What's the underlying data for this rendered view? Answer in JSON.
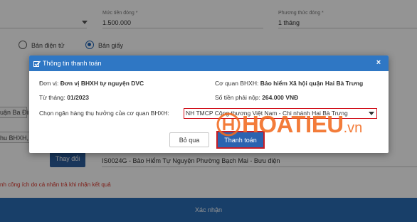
{
  "background": {
    "amount_label": "Mức tiền đóng *",
    "amount_value": "1.500.000",
    "method_label": "Phương thức đóng *",
    "method_value": "1 tháng",
    "radio_electronic": "Bản điện tử",
    "radio_paper": "Bản giấy",
    "left_text_1": "uận Ba Đình",
    "left_text_2": "hu BHXH, Bư",
    "change_button": "Thay đổi",
    "agency_text": "IS0024G - Bảo Hiểm Tự Nguyện Phường Bạch Mai - Bưu điện",
    "note_text": "nh công ích do cá nhân trả khi nhận kết quả",
    "confirm_button": "Xác nhận"
  },
  "modal": {
    "title": "Thông tin thanh toán",
    "unit_label": "Đơn vị:",
    "unit_value": "Đơn vị BHXH tự nguyện DVC",
    "agency_label": "Cơ quan BHXH:",
    "agency_value": "Bảo hiểm Xã hội quận Hai Bà Trưng",
    "from_label": "Từ tháng:",
    "from_value": "01/2023",
    "amount_label": "Số tiền phải nộp:",
    "amount_value": "264.000 VNĐ",
    "bank_label": "Chọn ngân hàng thụ hưởng của cơ quan BHXH:",
    "bank_selected": "NH TMCP Công thương Việt Nam - Chi nhánh Hai Bà Trưng",
    "skip_button": "Bỏ qua",
    "pay_button": "Thanh toán"
  },
  "watermark": {
    "text": "HOATIEU",
    "suffix": ".vn"
  },
  "colors": {
    "header_blue": "#2f77c4",
    "button_blue": "#2b63b0",
    "highlight_red": "#d0101b",
    "watermark_orange": "#f26b1f"
  }
}
